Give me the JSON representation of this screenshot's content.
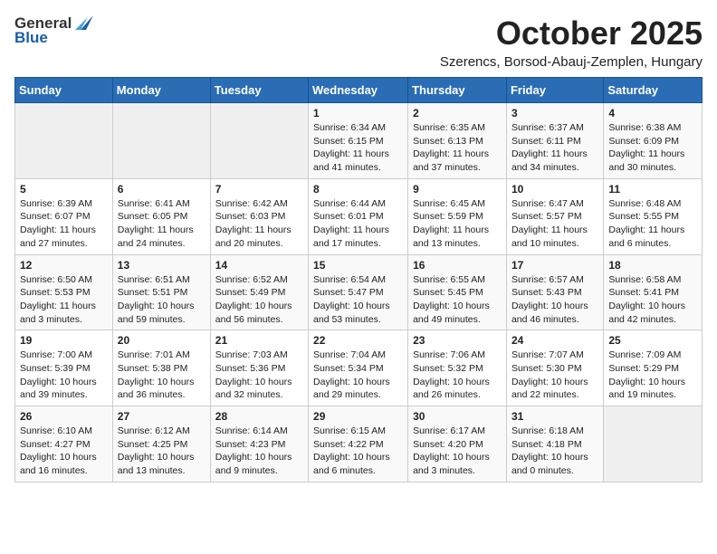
{
  "header": {
    "logo_general": "General",
    "logo_blue": "Blue",
    "month": "October 2025",
    "location": "Szerencs, Borsod-Abauj-Zemplen, Hungary"
  },
  "weekdays": [
    "Sunday",
    "Monday",
    "Tuesday",
    "Wednesday",
    "Thursday",
    "Friday",
    "Saturday"
  ],
  "weeks": [
    [
      {
        "day": "",
        "info": ""
      },
      {
        "day": "",
        "info": ""
      },
      {
        "day": "",
        "info": ""
      },
      {
        "day": "1",
        "info": "Sunrise: 6:34 AM\nSunset: 6:15 PM\nDaylight: 11 hours\nand 41 minutes."
      },
      {
        "day": "2",
        "info": "Sunrise: 6:35 AM\nSunset: 6:13 PM\nDaylight: 11 hours\nand 37 minutes."
      },
      {
        "day": "3",
        "info": "Sunrise: 6:37 AM\nSunset: 6:11 PM\nDaylight: 11 hours\nand 34 minutes."
      },
      {
        "day": "4",
        "info": "Sunrise: 6:38 AM\nSunset: 6:09 PM\nDaylight: 11 hours\nand 30 minutes."
      }
    ],
    [
      {
        "day": "5",
        "info": "Sunrise: 6:39 AM\nSunset: 6:07 PM\nDaylight: 11 hours\nand 27 minutes."
      },
      {
        "day": "6",
        "info": "Sunrise: 6:41 AM\nSunset: 6:05 PM\nDaylight: 11 hours\nand 24 minutes."
      },
      {
        "day": "7",
        "info": "Sunrise: 6:42 AM\nSunset: 6:03 PM\nDaylight: 11 hours\nand 20 minutes."
      },
      {
        "day": "8",
        "info": "Sunrise: 6:44 AM\nSunset: 6:01 PM\nDaylight: 11 hours\nand 17 minutes."
      },
      {
        "day": "9",
        "info": "Sunrise: 6:45 AM\nSunset: 5:59 PM\nDaylight: 11 hours\nand 13 minutes."
      },
      {
        "day": "10",
        "info": "Sunrise: 6:47 AM\nSunset: 5:57 PM\nDaylight: 11 hours\nand 10 minutes."
      },
      {
        "day": "11",
        "info": "Sunrise: 6:48 AM\nSunset: 5:55 PM\nDaylight: 11 hours\nand 6 minutes."
      }
    ],
    [
      {
        "day": "12",
        "info": "Sunrise: 6:50 AM\nSunset: 5:53 PM\nDaylight: 11 hours\nand 3 minutes."
      },
      {
        "day": "13",
        "info": "Sunrise: 6:51 AM\nSunset: 5:51 PM\nDaylight: 10 hours\nand 59 minutes."
      },
      {
        "day": "14",
        "info": "Sunrise: 6:52 AM\nSunset: 5:49 PM\nDaylight: 10 hours\nand 56 minutes."
      },
      {
        "day": "15",
        "info": "Sunrise: 6:54 AM\nSunset: 5:47 PM\nDaylight: 10 hours\nand 53 minutes."
      },
      {
        "day": "16",
        "info": "Sunrise: 6:55 AM\nSunset: 5:45 PM\nDaylight: 10 hours\nand 49 minutes."
      },
      {
        "day": "17",
        "info": "Sunrise: 6:57 AM\nSunset: 5:43 PM\nDaylight: 10 hours\nand 46 minutes."
      },
      {
        "day": "18",
        "info": "Sunrise: 6:58 AM\nSunset: 5:41 PM\nDaylight: 10 hours\nand 42 minutes."
      }
    ],
    [
      {
        "day": "19",
        "info": "Sunrise: 7:00 AM\nSunset: 5:39 PM\nDaylight: 10 hours\nand 39 minutes."
      },
      {
        "day": "20",
        "info": "Sunrise: 7:01 AM\nSunset: 5:38 PM\nDaylight: 10 hours\nand 36 minutes."
      },
      {
        "day": "21",
        "info": "Sunrise: 7:03 AM\nSunset: 5:36 PM\nDaylight: 10 hours\nand 32 minutes."
      },
      {
        "day": "22",
        "info": "Sunrise: 7:04 AM\nSunset: 5:34 PM\nDaylight: 10 hours\nand 29 minutes."
      },
      {
        "day": "23",
        "info": "Sunrise: 7:06 AM\nSunset: 5:32 PM\nDaylight: 10 hours\nand 26 minutes."
      },
      {
        "day": "24",
        "info": "Sunrise: 7:07 AM\nSunset: 5:30 PM\nDaylight: 10 hours\nand 22 minutes."
      },
      {
        "day": "25",
        "info": "Sunrise: 7:09 AM\nSunset: 5:29 PM\nDaylight: 10 hours\nand 19 minutes."
      }
    ],
    [
      {
        "day": "26",
        "info": "Sunrise: 6:10 AM\nSunset: 4:27 PM\nDaylight: 10 hours\nand 16 minutes."
      },
      {
        "day": "27",
        "info": "Sunrise: 6:12 AM\nSunset: 4:25 PM\nDaylight: 10 hours\nand 13 minutes."
      },
      {
        "day": "28",
        "info": "Sunrise: 6:14 AM\nSunset: 4:23 PM\nDaylight: 10 hours\nand 9 minutes."
      },
      {
        "day": "29",
        "info": "Sunrise: 6:15 AM\nSunset: 4:22 PM\nDaylight: 10 hours\nand 6 minutes."
      },
      {
        "day": "30",
        "info": "Sunrise: 6:17 AM\nSunset: 4:20 PM\nDaylight: 10 hours\nand 3 minutes."
      },
      {
        "day": "31",
        "info": "Sunrise: 6:18 AM\nSunset: 4:18 PM\nDaylight: 10 hours\nand 0 minutes."
      },
      {
        "day": "",
        "info": ""
      }
    ]
  ]
}
